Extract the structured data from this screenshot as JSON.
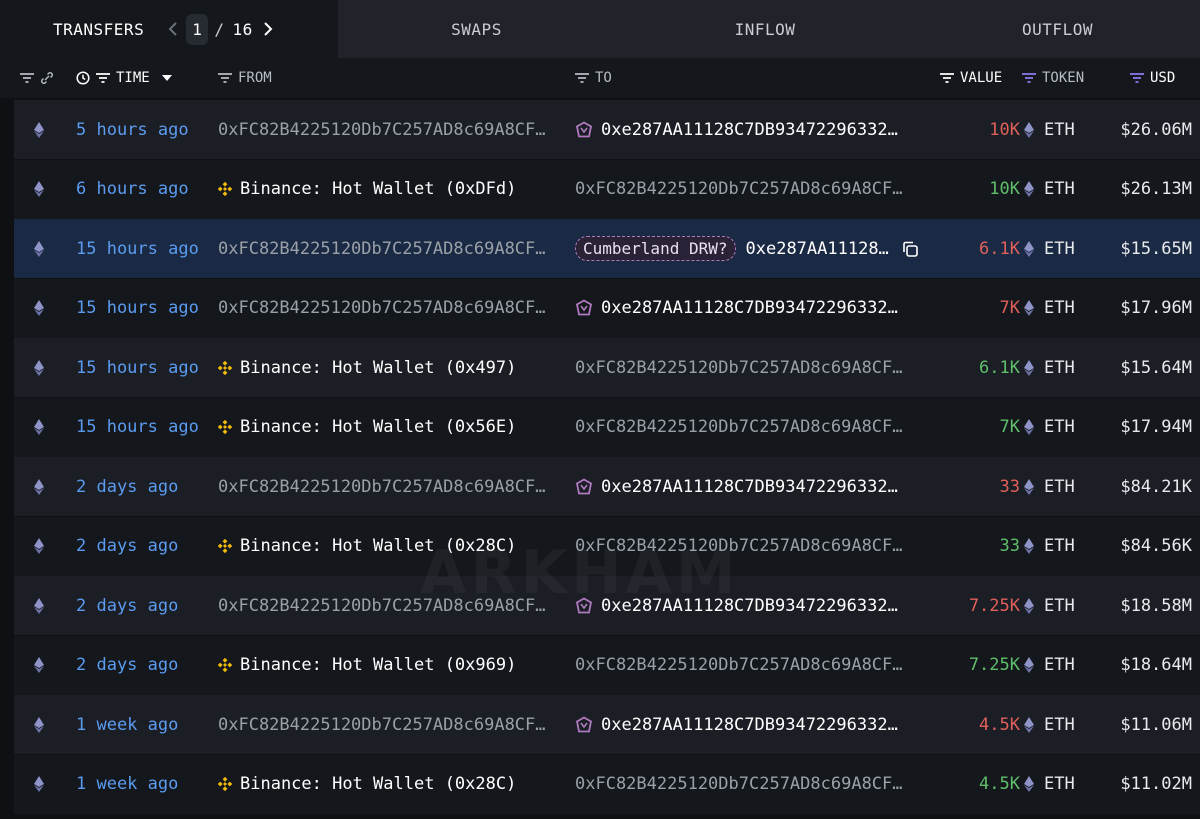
{
  "tabs": {
    "transfers": "TRANSFERS",
    "page_current": "1",
    "page_sep": "/",
    "page_total": "16",
    "swaps": "SWAPS",
    "inflow": "INFLOW",
    "outflow": "OUTFLOW"
  },
  "columns": {
    "time": "TIME",
    "from": "FROM",
    "to": "TO",
    "value": "VALUE",
    "token": "TOKEN",
    "usd": "USD"
  },
  "watermark": "ARKHAM",
  "colors": {
    "accent_blue": "#5b9bf0",
    "value_red": "#e0605a",
    "value_green": "#5fbf6a",
    "binance_yellow": "#f0b90b",
    "cumberland_purple": "#b07ac0",
    "row_highlight": "#1b2a44"
  },
  "rows": [
    {
      "time": "5 hours ago",
      "from": "0xFC82B4225120Db7C257AD8c69A8CF…",
      "from_icon": "",
      "to": "0xe287AA11128C7DB93472296332…",
      "to_icon": "cumberland-icon",
      "to_tag": "",
      "value": "10K",
      "direction": "out",
      "token": "ETH",
      "usd": "$26.06M"
    },
    {
      "time": "6 hours ago",
      "from": "Binance: Hot Wallet (0xDFd)",
      "from_icon": "binance-icon",
      "to": "0xFC82B4225120Db7C257AD8c69A8CF…",
      "to_icon": "",
      "to_tag": "",
      "value": "10K",
      "direction": "in",
      "token": "ETH",
      "usd": "$26.13M"
    },
    {
      "time": "15 hours ago",
      "from": "0xFC82B4225120Db7C257AD8c69A8CF…",
      "from_icon": "",
      "to": "0xe287AA11128…",
      "to_icon": "",
      "to_tag": "Cumberland DRW?",
      "value": "6.1K",
      "direction": "out",
      "token": "ETH",
      "usd": "$15.65M"
    },
    {
      "time": "15 hours ago",
      "from": "0xFC82B4225120Db7C257AD8c69A8CF…",
      "from_icon": "",
      "to": "0xe287AA11128C7DB93472296332…",
      "to_icon": "cumberland-icon",
      "to_tag": "",
      "value": "7K",
      "direction": "out",
      "token": "ETH",
      "usd": "$17.96M"
    },
    {
      "time": "15 hours ago",
      "from": "Binance: Hot Wallet (0x497)",
      "from_icon": "binance-icon",
      "to": "0xFC82B4225120Db7C257AD8c69A8CF…",
      "to_icon": "",
      "to_tag": "",
      "value": "6.1K",
      "direction": "in",
      "token": "ETH",
      "usd": "$15.64M"
    },
    {
      "time": "15 hours ago",
      "from": "Binance: Hot Wallet (0x56E)",
      "from_icon": "binance-icon",
      "to": "0xFC82B4225120Db7C257AD8c69A8CF…",
      "to_icon": "",
      "to_tag": "",
      "value": "7K",
      "direction": "in",
      "token": "ETH",
      "usd": "$17.94M"
    },
    {
      "time": "2 days ago",
      "from": "0xFC82B4225120Db7C257AD8c69A8CF…",
      "from_icon": "",
      "to": "0xe287AA11128C7DB93472296332…",
      "to_icon": "cumberland-icon",
      "to_tag": "",
      "value": "33",
      "direction": "out",
      "token": "ETH",
      "usd": "$84.21K"
    },
    {
      "time": "2 days ago",
      "from": "Binance: Hot Wallet (0x28C)",
      "from_icon": "binance-icon",
      "to": "0xFC82B4225120Db7C257AD8c69A8CF…",
      "to_icon": "",
      "to_tag": "",
      "value": "33",
      "direction": "in",
      "token": "ETH",
      "usd": "$84.56K"
    },
    {
      "time": "2 days ago",
      "from": "0xFC82B4225120Db7C257AD8c69A8CF…",
      "from_icon": "",
      "to": "0xe287AA11128C7DB93472296332…",
      "to_icon": "cumberland-icon",
      "to_tag": "",
      "value": "7.25K",
      "direction": "out",
      "token": "ETH",
      "usd": "$18.58M"
    },
    {
      "time": "2 days ago",
      "from": "Binance: Hot Wallet (0x969)",
      "from_icon": "binance-icon",
      "to": "0xFC82B4225120Db7C257AD8c69A8CF…",
      "to_icon": "",
      "to_tag": "",
      "value": "7.25K",
      "direction": "in",
      "token": "ETH",
      "usd": "$18.64M"
    },
    {
      "time": "1 week ago",
      "from": "0xFC82B4225120Db7C257AD8c69A8CF…",
      "from_icon": "",
      "to": "0xe287AA11128C7DB93472296332…",
      "to_icon": "cumberland-icon",
      "to_tag": "",
      "value": "4.5K",
      "direction": "out",
      "token": "ETH",
      "usd": "$11.06M"
    },
    {
      "time": "1 week ago",
      "from": "Binance: Hot Wallet (0x28C)",
      "from_icon": "binance-icon",
      "to": "0xFC82B4225120Db7C257AD8c69A8CF…",
      "to_icon": "",
      "to_tag": "",
      "value": "4.5K",
      "direction": "in",
      "token": "ETH",
      "usd": "$11.02M"
    }
  ]
}
